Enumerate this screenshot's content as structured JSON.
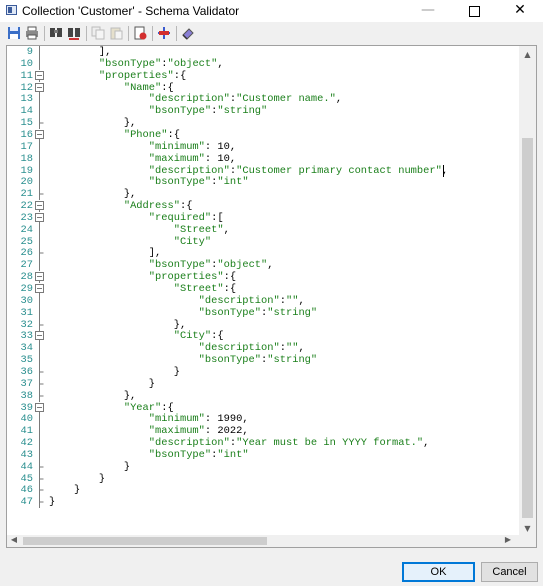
{
  "window": {
    "title": "Collection 'Customer' - Schema Validator",
    "controls": {
      "minimize": "—",
      "close": "✕"
    }
  },
  "toolbar": {
    "buttons": [
      "save-icon",
      "print-icon",
      "find-icon",
      "find-replace-icon",
      "copy-icon",
      "paste-icon",
      "validate-icon",
      "format-icon",
      "clear-icon"
    ]
  },
  "editor": {
    "lines": [
      {
        "n": "9",
        "code": "        ],",
        "fold": "line"
      },
      {
        "n": "10",
        "code": "        \"bsonType\":\"object\",",
        "fold": "line"
      },
      {
        "n": "11",
        "code": "        \"properties\":{",
        "fold": "box"
      },
      {
        "n": "12",
        "code": "            \"Name\":{",
        "fold": "box"
      },
      {
        "n": "13",
        "code": "                \"description\":\"Customer name.\",",
        "fold": "line"
      },
      {
        "n": "14",
        "code": "                \"bsonType\":\"string\"",
        "fold": "line"
      },
      {
        "n": "15",
        "code": "            },",
        "fold": "end"
      },
      {
        "n": "16",
        "code": "            \"Phone\":{",
        "fold": "box"
      },
      {
        "n": "17",
        "code": "                \"minimum\": 10,",
        "fold": "line"
      },
      {
        "n": "18",
        "code": "                \"maximum\": 10,",
        "fold": "line"
      },
      {
        "n": "19",
        "code": "                \"description\":\"Customer primary contact number\",",
        "fold": "line"
      },
      {
        "n": "20",
        "code": "                \"bsonType\":\"int\"",
        "fold": "line"
      },
      {
        "n": "21",
        "code": "            },",
        "fold": "end"
      },
      {
        "n": "22",
        "code": "            \"Address\":{",
        "fold": "box"
      },
      {
        "n": "23",
        "code": "                \"required\":[",
        "fold": "box"
      },
      {
        "n": "24",
        "code": "                    \"Street\",",
        "fold": "line"
      },
      {
        "n": "25",
        "code": "                    \"City\"",
        "fold": "line"
      },
      {
        "n": "26",
        "code": "                ],",
        "fold": "end"
      },
      {
        "n": "27",
        "code": "                \"bsonType\":\"object\",",
        "fold": "line"
      },
      {
        "n": "28",
        "code": "                \"properties\":{",
        "fold": "box"
      },
      {
        "n": "29",
        "code": "                    \"Street\":{",
        "fold": "box"
      },
      {
        "n": "30",
        "code": "                        \"description\":\"\",",
        "fold": "line"
      },
      {
        "n": "31",
        "code": "                        \"bsonType\":\"string\"",
        "fold": "line"
      },
      {
        "n": "32",
        "code": "                    },",
        "fold": "end"
      },
      {
        "n": "33",
        "code": "                    \"City\":{",
        "fold": "box"
      },
      {
        "n": "34",
        "code": "                        \"description\":\"\",",
        "fold": "line"
      },
      {
        "n": "35",
        "code": "                        \"bsonType\":\"string\"",
        "fold": "line"
      },
      {
        "n": "36",
        "code": "                    }",
        "fold": "end"
      },
      {
        "n": "37",
        "code": "                }",
        "fold": "end"
      },
      {
        "n": "38",
        "code": "            },",
        "fold": "end"
      },
      {
        "n": "39",
        "code": "            \"Year\":{",
        "fold": "box"
      },
      {
        "n": "40",
        "code": "                \"minimum\": 1990,",
        "fold": "line"
      },
      {
        "n": "41",
        "code": "                \"maximum\": 2022,",
        "fold": "line"
      },
      {
        "n": "42",
        "code": "                \"description\":\"Year must be in YYYY format.\",",
        "fold": "line"
      },
      {
        "n": "43",
        "code": "                \"bsonType\":\"int\"",
        "fold": "line"
      },
      {
        "n": "44",
        "code": "            }",
        "fold": "end"
      },
      {
        "n": "45",
        "code": "        }",
        "fold": "end"
      },
      {
        "n": "46",
        "code": "    }",
        "fold": "end"
      },
      {
        "n": "47",
        "code": "}",
        "fold": "end"
      }
    ],
    "caret": {
      "line": "19",
      "column": 63
    },
    "colors": {
      "line_numbers": "#2a8f8f",
      "strings": "#1a7f1a",
      "text": "#000000"
    }
  },
  "scrollbars": {
    "up_arrow": "▲",
    "down_arrow": "▼",
    "left_arrow": "◀",
    "right_arrow": "▶"
  },
  "footer": {
    "ok_label": "OK",
    "cancel_label": "Cancel"
  }
}
